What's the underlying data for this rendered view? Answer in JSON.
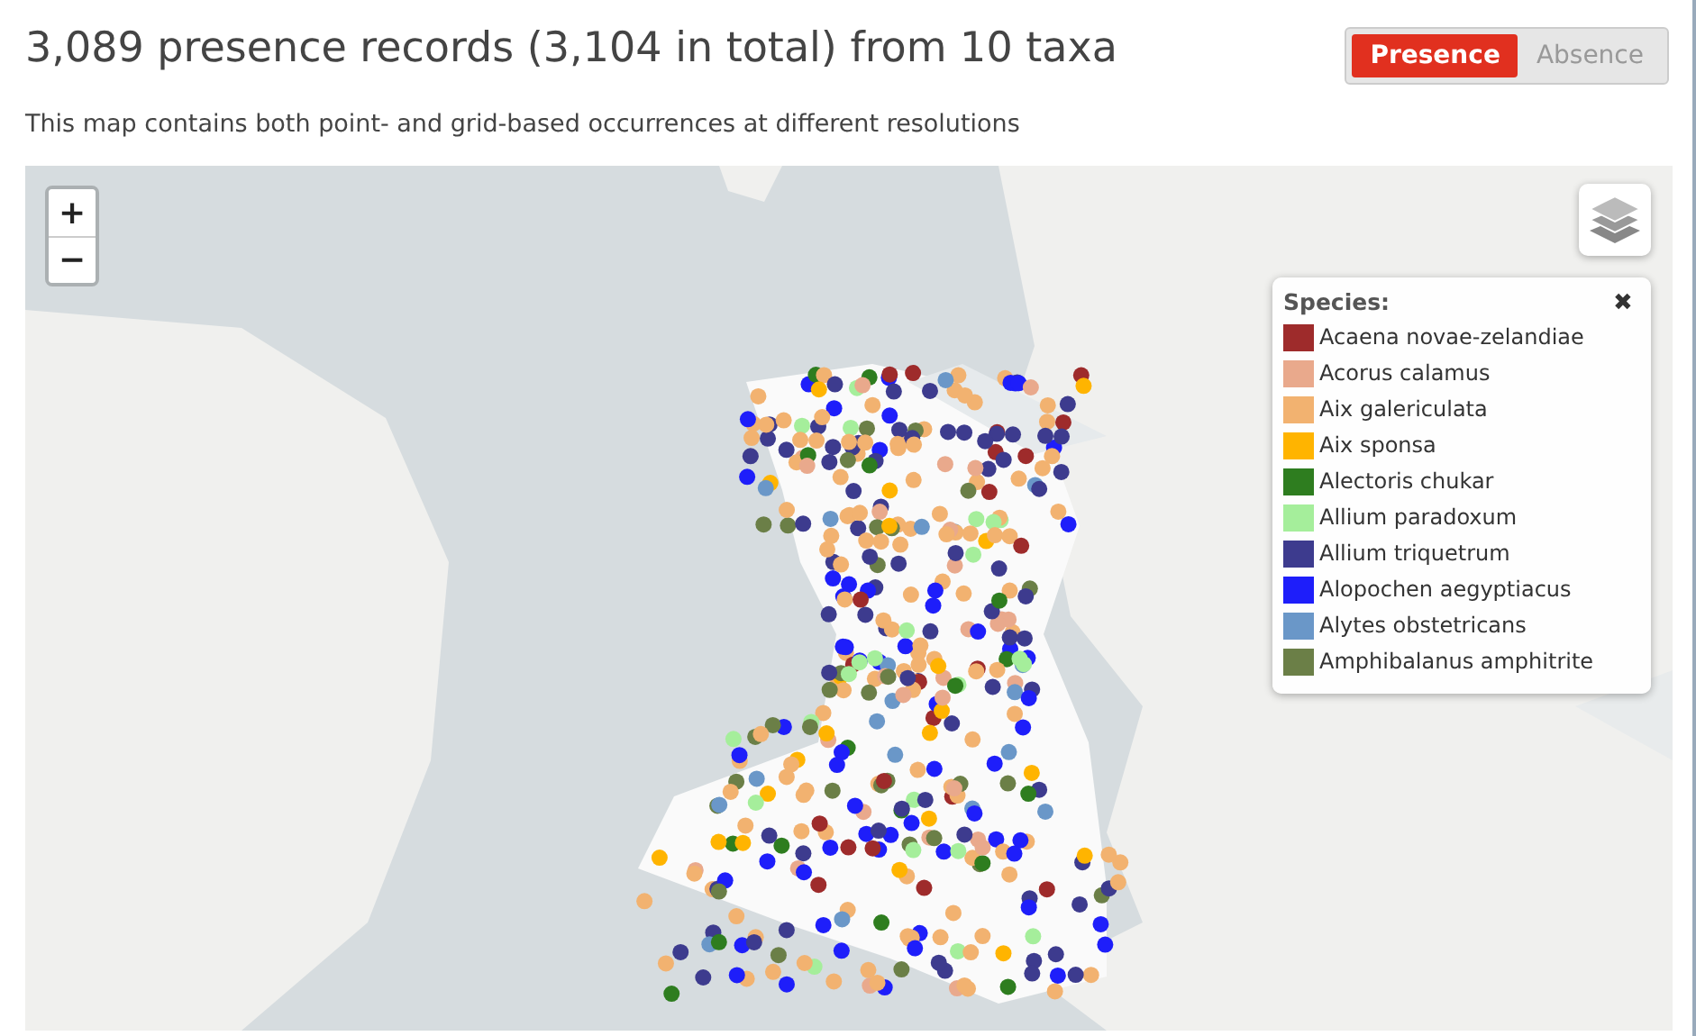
{
  "header": {
    "title": "3,089 presence records (3,104 in total) from 10 taxa",
    "subtitle": "This map contains both point- and grid-based occurrences at different resolutions"
  },
  "toggle": [
    {
      "label": "Presence",
      "selected": true
    },
    {
      "label": "Absence",
      "selected": false
    }
  ],
  "map": {
    "kind": "picture",
    "zoom_in": "+",
    "zoom_out": "−"
  },
  "legend": {
    "title": "Species:",
    "close": "✖",
    "items": [
      {
        "label": "Acaena novae-zelandiae",
        "color": "#9e2b2b"
      },
      {
        "label": "Acorus calamus",
        "color": "#e9a98c"
      },
      {
        "label": "Aix galericulata",
        "color": "#f2b270"
      },
      {
        "label": "Aix sponsa",
        "color": "#ffb400"
      },
      {
        "label": "Alectoris chukar",
        "color": "#2e7d1f"
      },
      {
        "label": "Allium paradoxum",
        "color": "#a5ee9b"
      },
      {
        "label": "Allium triquetrum",
        "color": "#3d3b8e"
      },
      {
        "label": "Alopochen aegyptiacus",
        "color": "#1e1efa"
      },
      {
        "label": "Alytes obstetricans",
        "color": "#6a97c8"
      },
      {
        "label": "Amphibalanus amphitrite",
        "color": "#6b7f47"
      }
    ]
  }
}
